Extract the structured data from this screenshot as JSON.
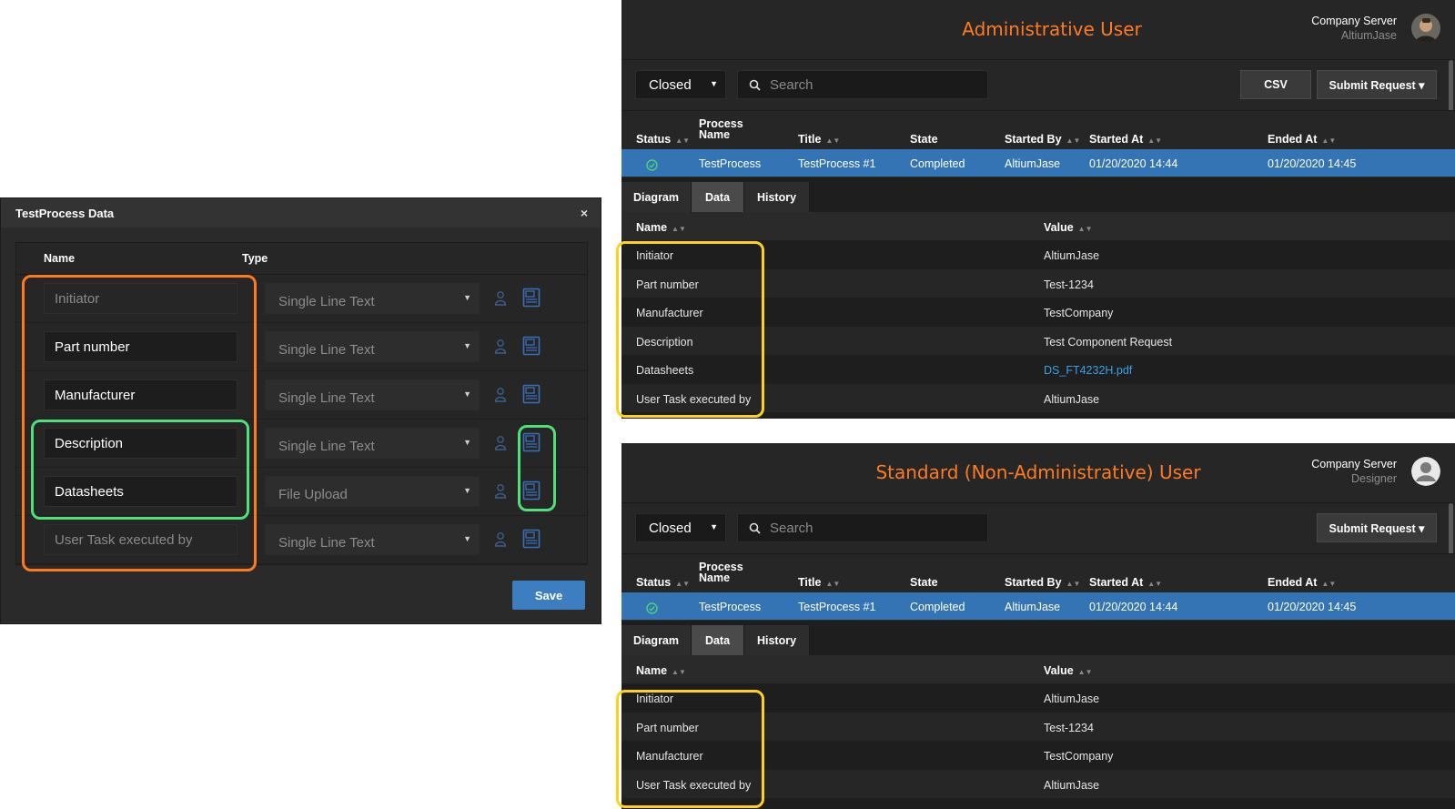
{
  "dialog": {
    "title": "TestProcess Data",
    "close_glyph": "×",
    "col_name": "Name",
    "col_type": "Type",
    "rows": [
      {
        "name": "Initiator",
        "type": "Single Line Text",
        "editable": false
      },
      {
        "name": "Part number",
        "type": "Single Line Text",
        "editable": true
      },
      {
        "name": "Manufacturer",
        "type": "Single Line Text",
        "editable": true
      },
      {
        "name": "Description",
        "type": "Single Line Text",
        "editable": true
      },
      {
        "name": "Datasheets",
        "type": "File Upload",
        "editable": true
      },
      {
        "name": "User Task executed by",
        "type": "Single Line Text",
        "editable": false
      }
    ],
    "save_label": "Save"
  },
  "admin": {
    "heading": "Administrative User",
    "server": "Company Server",
    "user": "AltiumJase",
    "filter_value": "Closed",
    "search_placeholder": "Search",
    "csv_label": "CSV",
    "submit_label": "Submit Request ▾",
    "table_headers": {
      "status": "Status",
      "process_name_1": "Process",
      "process_name_2": "Name",
      "title": "Title",
      "state": "State",
      "started_by": "Started By",
      "started_at": "Started At",
      "ended_at": "Ended At"
    },
    "row": {
      "process_name": "TestProcess",
      "title": "TestProcess #1",
      "state": "Completed",
      "started_by": "AltiumJase",
      "started_at": "01/20/2020 14:44",
      "ended_at": "01/20/2020 14:45"
    },
    "tabs": [
      "Diagram",
      "Data",
      "History"
    ],
    "data_headers": {
      "name": "Name",
      "value": "Value"
    },
    "data_rows": [
      {
        "name": "Initiator",
        "value": "AltiumJase"
      },
      {
        "name": "Part number",
        "value": "Test-1234"
      },
      {
        "name": "Manufacturer",
        "value": "TestCompany"
      },
      {
        "name": "Description",
        "value": "Test Component Request"
      },
      {
        "name": "Datasheets",
        "value": "DS_FT4232H.pdf"
      },
      {
        "name": "User Task executed by",
        "value": "AltiumJase"
      }
    ]
  },
  "standard": {
    "heading": "Standard (Non-Administrative) User",
    "server": "Company Server",
    "user": "Designer",
    "filter_value": "Closed",
    "search_placeholder": "Search",
    "submit_label": "Submit Request ▾",
    "table_headers": {
      "status": "Status",
      "process_name_1": "Process",
      "process_name_2": "Name",
      "title": "Title",
      "state": "State",
      "started_by": "Started By",
      "started_at": "Started At",
      "ended_at": "Ended At"
    },
    "row": {
      "process_name": "TestProcess",
      "title": "TestProcess #1",
      "state": "Completed",
      "started_by": "AltiumJase",
      "started_at": "01/20/2020 14:44",
      "ended_at": "01/20/2020 14:45"
    },
    "tabs": [
      "Diagram",
      "Data",
      "History"
    ],
    "data_headers": {
      "name": "Name",
      "value": "Value"
    },
    "data_rows": [
      {
        "name": "Initiator",
        "value": "AltiumJase"
      },
      {
        "name": "Part number",
        "value": "Test-1234"
      },
      {
        "name": "Manufacturer",
        "value": "TestCompany"
      },
      {
        "name": "User Task executed by",
        "value": "AltiumJase"
      }
    ]
  },
  "colors": {
    "accent_orange": "#ff7b22",
    "highlight_orange": "#ff7a1a",
    "highlight_green": "#4fe07a",
    "highlight_yellow": "#ffd21a",
    "selected_row": "#3474b4",
    "link": "#3aa0e6",
    "save_button": "#3d7ec0"
  },
  "icons": {
    "close": "close-icon",
    "user": "user-icon",
    "document": "document-icon",
    "search": "search-icon",
    "status_ok": "check-circle-icon",
    "sort": "sort-icon",
    "caret": "caret-down-icon"
  }
}
